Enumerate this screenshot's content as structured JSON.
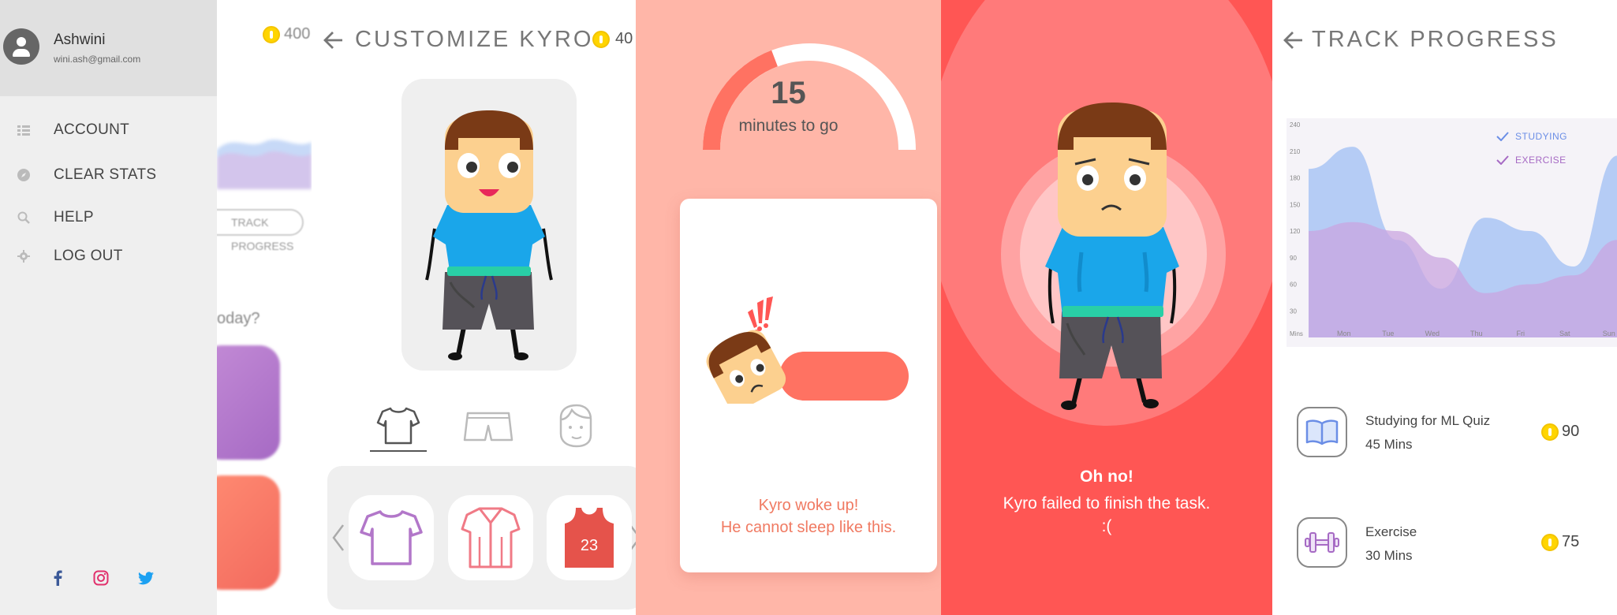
{
  "drawer": {
    "user_name": "Ashwini",
    "user_email": "wini.ash@gmail.com",
    "menu": [
      {
        "label": "ACCOUNT",
        "icon": "list-icon"
      },
      {
        "label": "CLEAR STATS",
        "icon": "compass-icon"
      },
      {
        "label": "HELP",
        "icon": "search-icon"
      },
      {
        "label": "LOG OUT",
        "icon": "gear-icon"
      }
    ],
    "social": [
      {
        "icon": "facebook-icon",
        "color": "#3b5998"
      },
      {
        "icon": "instagram-icon",
        "color": "#e1306c"
      },
      {
        "icon": "twitter-icon",
        "color": "#1da1f2"
      }
    ],
    "background": {
      "coins": "400",
      "pill_label": "TRACK PROGRESS",
      "question": "oday?"
    }
  },
  "customize": {
    "title": "CUSTOMIZE KYRO",
    "coins": "40",
    "categories": [
      "shirt-icon",
      "shorts-icon",
      "face-icon"
    ],
    "items": [
      {
        "icon": "tshirt-item-icon",
        "color": "#b277c9"
      },
      {
        "icon": "button-shirt-item-icon",
        "color": "#f07a86"
      },
      {
        "icon": "jersey-item-icon",
        "color": "#e5534b",
        "number": "23"
      }
    ]
  },
  "timer": {
    "value": "15",
    "label": "minutes to go",
    "progress": 0.2,
    "message_line1": "Kyro woke up!",
    "message_line2": "He cannot sleep like this."
  },
  "fail": {
    "title": "Oh no!",
    "line1": "Kyro failed to finish the task.",
    "line2": ":("
  },
  "track": {
    "title": "TRACK PROGRESS",
    "legend": [
      {
        "label": "STUDYING",
        "color": "#6b8ee6"
      },
      {
        "label": "EXERCISE",
        "color": "#a66ac4"
      }
    ],
    "tasks": [
      {
        "name": "Studying for ML Quiz",
        "duration": "45 Mins",
        "coins": "90",
        "icon": "book-icon"
      },
      {
        "name": "Exercise",
        "duration": "30 Mins",
        "coins": "75",
        "icon": "dumbbell-icon"
      }
    ]
  },
  "chart_data": {
    "type": "area",
    "title": "",
    "xlabel": "",
    "ylabel": "",
    "categories": [
      "Mon",
      "Tue",
      "Wed",
      "Thu",
      "Fri",
      "Sat",
      "Sun"
    ],
    "y_ticks": [
      30,
      60,
      90,
      120,
      150,
      180,
      210,
      240
    ],
    "y_unit": "Mins",
    "ylim": [
      0,
      240
    ],
    "legend_position": "top-right",
    "grid": false,
    "series": [
      {
        "name": "STUDYING",
        "x": [
          0,
          1,
          2,
          3,
          4,
          5,
          6,
          7
        ],
        "values": [
          190,
          215,
          110,
          55,
          135,
          120,
          80,
          205
        ],
        "color": "#a9c4f5"
      },
      {
        "name": "EXERCISE",
        "x": [
          0,
          1,
          2,
          3,
          4,
          5,
          6,
          7
        ],
        "values": [
          120,
          130,
          120,
          90,
          50,
          60,
          70,
          110
        ],
        "color": "#c9a6e0"
      }
    ]
  }
}
